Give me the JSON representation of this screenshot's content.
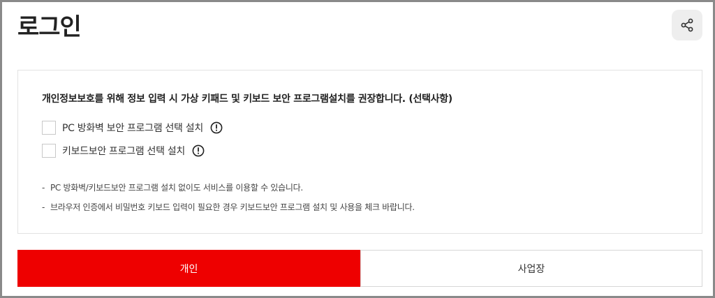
{
  "page": {
    "title": "로그인"
  },
  "header": {
    "share_icon": "share-icon"
  },
  "security": {
    "headline": "개인정보보호를 위해 정보 입력 시 가상 키패드 및 키보드 보안 프로그램설치를 권장합니다. (선택사항)",
    "options": [
      {
        "label": "PC 방화벽 보안 프로그램 선택 설치",
        "checked": false,
        "icon": "info-icon"
      },
      {
        "label": "키보드보안 프로그램 선택 설치",
        "checked": false,
        "icon": "info-icon"
      }
    ],
    "notes": [
      {
        "bullet": "-",
        "text": "PC 방화벽/키보드보안 프로그램 설치 없이도 서비스를 이용할 수 있습니다."
      },
      {
        "bullet": "-",
        "text": "브라우저 인증에서 비밀번호 키보드 입력이 필요한 경우 키보드보안 프로그램 설치 및 사용을 체크 바랍니다."
      }
    ]
  },
  "tabs": {
    "items": [
      {
        "label": "개인",
        "active": true
      },
      {
        "label": "사업장",
        "active": false
      }
    ]
  },
  "colors": {
    "accent": "#ee0000",
    "border": "#e2e2e2",
    "frame": "#8a8a8a"
  }
}
